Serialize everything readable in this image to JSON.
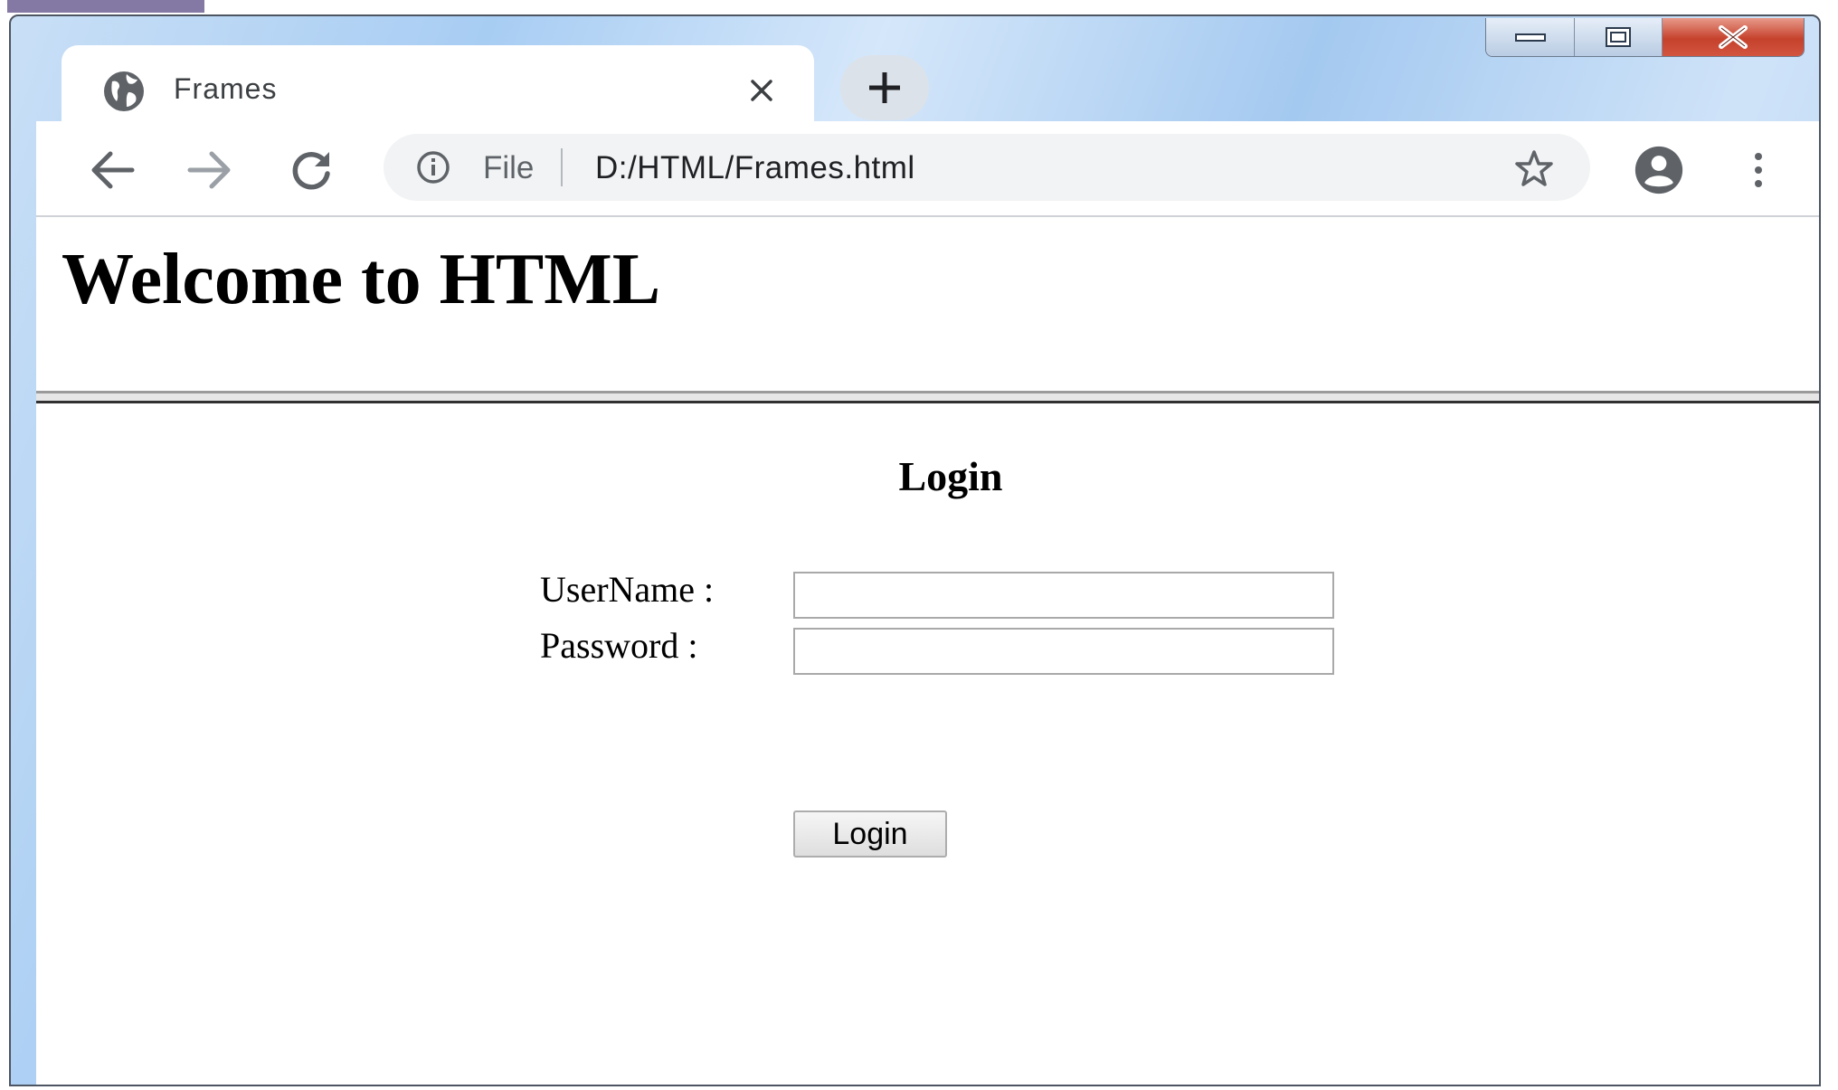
{
  "browser": {
    "tab": {
      "title": "Frames"
    },
    "address_bar": {
      "scheme_label": "File",
      "url": "D:/HTML/Frames.html"
    }
  },
  "page": {
    "top_frame": {
      "heading": "Welcome to HTML"
    },
    "bottom_frame": {
      "form_heading": "Login",
      "username_label": "UserName :",
      "username_value": "",
      "password_label": "Password :",
      "password_value": "",
      "submit_label": "Login"
    }
  },
  "icons": [
    "globe-icon",
    "tab-close-icon",
    "new-tab-icon",
    "back-arrow-icon",
    "forward-arrow-icon",
    "reload-icon",
    "info-icon",
    "star-icon",
    "account-icon",
    "menu-dots-icon",
    "minimize-icon",
    "maximize-icon",
    "close-icon"
  ],
  "colors": {
    "titlebar": "#a8cdf3",
    "close_button": "#c5412c",
    "omnibox_bg": "#f1f3f4"
  }
}
